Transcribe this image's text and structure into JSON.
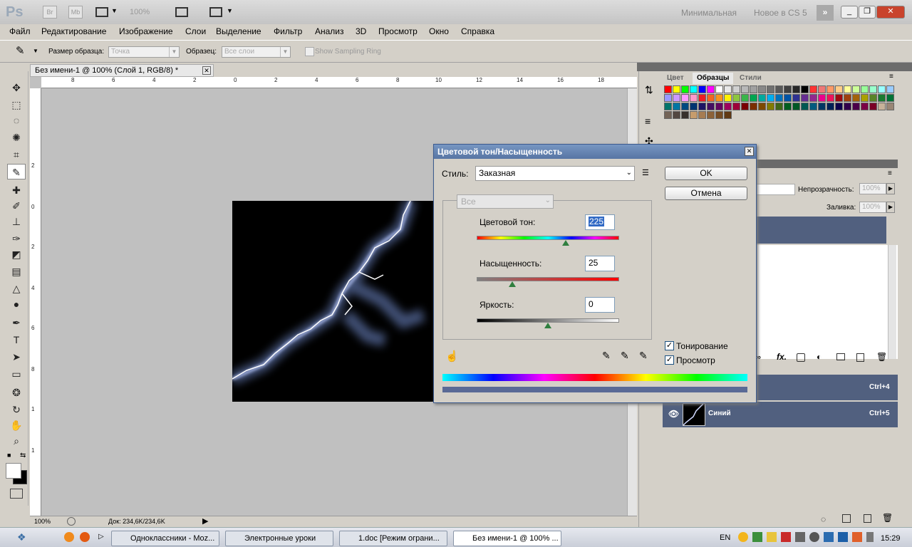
{
  "app": {
    "logo": "Ps",
    "bridge_btn": "Br",
    "minibridge_btn": "Mb",
    "zoom_value": "100%",
    "workspace_1": "Минимальная",
    "workspace_2": "Новое в CS 5",
    "more": "»"
  },
  "menu": [
    "Файл",
    "Редактирование",
    "Изображение",
    "Слои",
    "Выделение",
    "Фильтр",
    "Анализ",
    "3D",
    "Просмотр",
    "Окно",
    "Справка"
  ],
  "options": {
    "sample_size_label": "Размер образца:",
    "sample_size_value": "Точка",
    "sample_label": "Образец:",
    "sample_value": "Все слои",
    "sampling_ring": "Show Sampling Ring"
  },
  "document": {
    "tab_title": "Без имени-1 @ 100% (Слой 1, RGB/8) *",
    "zoom": "100%",
    "doc_info": "Док: 234,6K/234,6K",
    "ruler_h": [
      "8",
      "6",
      "4",
      "2",
      "0",
      "2",
      "4",
      "6",
      "8",
      "10",
      "12",
      "14",
      "16",
      "18"
    ],
    "ruler_v": [
      "2",
      "0",
      "2",
      "4",
      "6",
      "8",
      "1",
      "1"
    ]
  },
  "panels": {
    "tab_color": "Цвет",
    "tab_swatches": "Образцы",
    "tab_styles": "Стили",
    "opacity_label": "Непрозрачность:",
    "opacity_value": "100%",
    "fill_label": "Заливка:",
    "fill_value": "100%",
    "layers": [
      {
        "shortcut": "Ctrl+4",
        "name": ""
      },
      {
        "shortcut": "Ctrl+5",
        "name": "Синий"
      }
    ]
  },
  "swatch_colors": [
    "#ff0000",
    "#ffff00",
    "#00ff00",
    "#00ffff",
    "#0000ff",
    "#ff00ff",
    "#ffffff",
    "#e8e8e8",
    "#d0d0d0",
    "#b8b8b8",
    "#a0a0a0",
    "#888888",
    "#707070",
    "#585858",
    "#404040",
    "#282828",
    "#000000",
    "#ff3333",
    "#ee7777",
    "#ff9966",
    "#ffcc88",
    "#ffff99",
    "#ccff99",
    "#99ff99",
    "#99ffcc",
    "#99ffff",
    "#99ccff",
    "#9999ff",
    "#cc99ff",
    "#ff99ff",
    "#ff99cc",
    "#ed1c24",
    "#f26522",
    "#f7941d",
    "#fff200",
    "#8dc63f",
    "#39b54a",
    "#00a651",
    "#00a99d",
    "#00aeef",
    "#0072bc",
    "#0054a6",
    "#2e3192",
    "#662d91",
    "#92278f",
    "#ec008c",
    "#ed145b",
    "#9e0b0f",
    "#a0410d",
    "#a36209",
    "#aba000",
    "#598527",
    "#197b30",
    "#007236",
    "#00746b",
    "#0076a3",
    "#004a80",
    "#003471",
    "#1b1464",
    "#440e62",
    "#630460",
    "#9e005d",
    "#9e0039",
    "#790000",
    "#7b2e00",
    "#7d4900",
    "#827b00",
    "#406618",
    "#005e20",
    "#005826",
    "#005952",
    "#005b7f",
    "#003663",
    "#002157",
    "#0d004c",
    "#32004b",
    "#4b0049",
    "#7b0046",
    "#7a0026",
    "#c7b299",
    "#998675",
    "#736357",
    "#534741",
    "#37302d",
    "#c69c6d",
    "#a67c52",
    "#8c6239",
    "#754c24",
    "#603913"
  ],
  "dialog": {
    "title": "Цветовой тон/Насыщенность",
    "style_label": "Стиль:",
    "style_value": "Заказная",
    "ok": "OK",
    "cancel": "Отмена",
    "channel": "Все",
    "hue_label": "Цветовой тон:",
    "hue_value": "225",
    "saturation_label": "Насыщенность:",
    "saturation_value": "25",
    "lightness_label": "Яркость:",
    "lightness_value": "0",
    "colorize": "Тонирование",
    "preview": "Просмотр",
    "hue_fraction": 0.625,
    "saturation_fraction": 0.25,
    "lightness_fraction": 0.5,
    "result_color": "#5a6a96"
  },
  "taskbar": {
    "items": [
      "Одноклассники - Moz...",
      "Электронные уроки",
      "1.doc [Режим ограни...",
      "Без имени-1 @ 100% ..."
    ],
    "lang": "EN",
    "clock": "15:29"
  }
}
